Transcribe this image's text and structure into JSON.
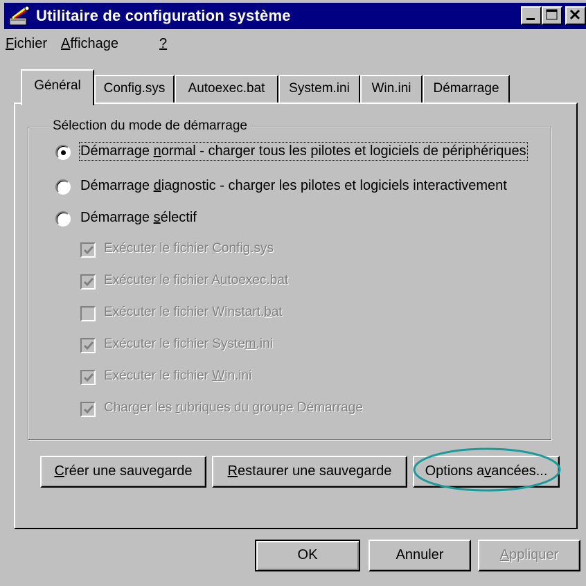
{
  "window": {
    "title": "Utilitaire de configuration système",
    "accent_color": "#000080",
    "title_icon": "msconfig-icon",
    "controls": [
      "minimize-icon",
      "maximize-icon",
      "close-icon"
    ]
  },
  "menu": {
    "items": [
      {
        "pre": "",
        "key": "F",
        "post": "ichier"
      },
      {
        "pre": "",
        "key": "A",
        "post": "ffichage"
      },
      {
        "pre": "",
        "key": "?",
        "post": ""
      }
    ]
  },
  "tabs": [
    {
      "label": "Général",
      "active": true
    },
    {
      "label": "Config.sys"
    },
    {
      "label": "Autoexec.bat"
    },
    {
      "label": "System.ini"
    },
    {
      "label": "Win.ini"
    },
    {
      "label": "Démarrage"
    }
  ],
  "group": {
    "legend": "Sélection du mode de démarrage",
    "radios": [
      {
        "pre": "Démarrage ",
        "key": "n",
        "post": "ormal - charger tous les pilotes et logiciels de périphériques",
        "selected": true
      },
      {
        "pre": "Démarrage ",
        "key": "d",
        "post": "iagnostic - charger les pilotes et logiciels interactivement",
        "selected": false
      },
      {
        "pre": "Démarrage ",
        "key": "s",
        "post": "électif",
        "selected": false
      }
    ],
    "checkboxes": [
      {
        "pre": "Exécuter le fichier ",
        "key": "C",
        "post": "onfig.sys",
        "checked": true
      },
      {
        "pre": "Exécuter le fichier A",
        "key": "u",
        "post": "toexec.bat",
        "checked": true
      },
      {
        "pre": "Exécuter le fichier Winstart.",
        "key": "b",
        "post": "at",
        "checked": false
      },
      {
        "pre": "Exécuter le fichier Syste",
        "key": "m",
        "post": ".ini",
        "checked": true
      },
      {
        "pre": "Exécuter le fichier ",
        "key": "W",
        "post": "in.ini",
        "checked": true
      },
      {
        "pre": "Charger les ",
        "key": "r",
        "post": "ubriques du groupe Démarrage",
        "checked": true
      }
    ]
  },
  "actions": {
    "backup": {
      "pre": "",
      "key": "C",
      "post": "réer une sauvegarde"
    },
    "restore": {
      "pre": "",
      "key": "R",
      "post": "estaurer une sauvegarde"
    },
    "advanced": {
      "pre": "Options a",
      "key": "v",
      "post": "ancées...",
      "highlight_color": "#1a9a9a"
    }
  },
  "dialog_buttons": {
    "ok": "OK",
    "cancel": "Annuler",
    "apply": {
      "pre": "",
      "key": "A",
      "post": "ppliquer",
      "disabled": true
    }
  }
}
